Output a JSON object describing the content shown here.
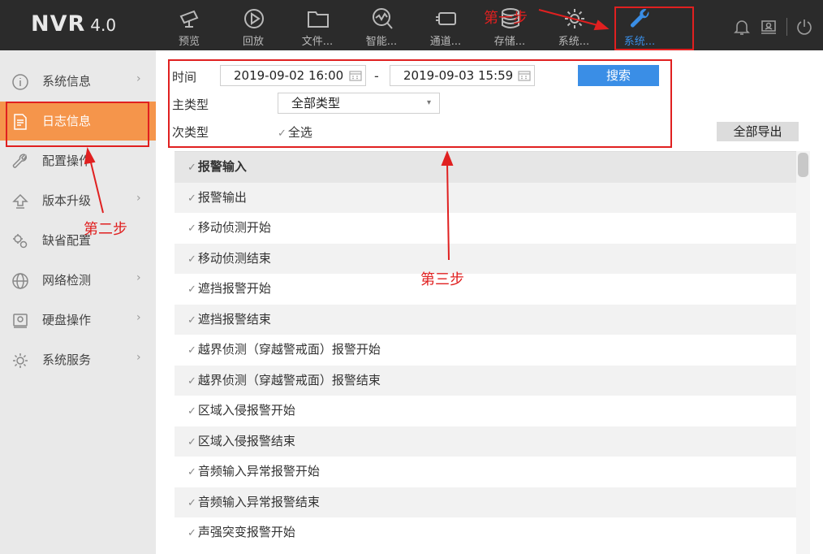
{
  "logo": {
    "name": "NVR",
    "version": "4.0"
  },
  "tabs": [
    {
      "label": "预览",
      "icon": "camera-icon"
    },
    {
      "label": "回放",
      "icon": "play-icon"
    },
    {
      "label": "文件...",
      "icon": "folder-icon"
    },
    {
      "label": "智能...",
      "icon": "smart-analysis-icon"
    },
    {
      "label": "通道...",
      "icon": "channel-icon"
    },
    {
      "label": "存储...",
      "icon": "database-icon"
    },
    {
      "label": "系统...",
      "icon": "gear-icon"
    },
    {
      "label": "系统...",
      "icon": "wrench-icon",
      "active": true
    }
  ],
  "top_right_icons": [
    "bell-icon",
    "user-icon",
    "power-icon"
  ],
  "sidebar": {
    "items": [
      {
        "label": "系统信息",
        "icon": "info-icon",
        "chevron": "›"
      },
      {
        "label": "日志信息",
        "icon": "document-icon",
        "chevron": "",
        "active": true
      },
      {
        "label": "配置操作",
        "icon": "wrench-icon",
        "chevron": ""
      },
      {
        "label": "版本升级",
        "icon": "upgrade-icon",
        "chevron": "›"
      },
      {
        "label": "缺省配置",
        "icon": "gears-icon",
        "chevron": ""
      },
      {
        "label": "网络检测",
        "icon": "globe-icon",
        "chevron": "›"
      },
      {
        "label": "硬盘操作",
        "icon": "disk-icon",
        "chevron": "›"
      },
      {
        "label": "系统服务",
        "icon": "service-icon",
        "chevron": "›"
      }
    ]
  },
  "filter": {
    "time_label": "时间",
    "start_time": "2019-09-02 16:00",
    "time_separator": "-",
    "end_time": "2019-09-03 15:59",
    "search_label": "搜索",
    "main_type_label": "主类型",
    "main_type_value": "全部类型",
    "sub_type_label": "次类型",
    "select_all_label": "全选",
    "export_label": "全部导出"
  },
  "log_types": [
    "报警输入",
    "报警输出",
    "移动侦测开始",
    "移动侦测结束",
    "遮挡报警开始",
    "遮挡报警结束",
    "越界侦测（穿越警戒面）报警开始",
    "越界侦测（穿越警戒面）报警结束",
    "区域入侵报警开始",
    "区域入侵报警结束",
    "音频输入异常报警开始",
    "音频输入异常报警结束",
    "声强突变报警开始"
  ],
  "annotations": {
    "step1": "第一步",
    "step2": "第二步",
    "step3": "第三步",
    "color": "#e02020"
  },
  "colors": {
    "accent": "#3a8ee6",
    "sidebar_active": "#f5954b",
    "topbar": "#2b2b2b"
  }
}
